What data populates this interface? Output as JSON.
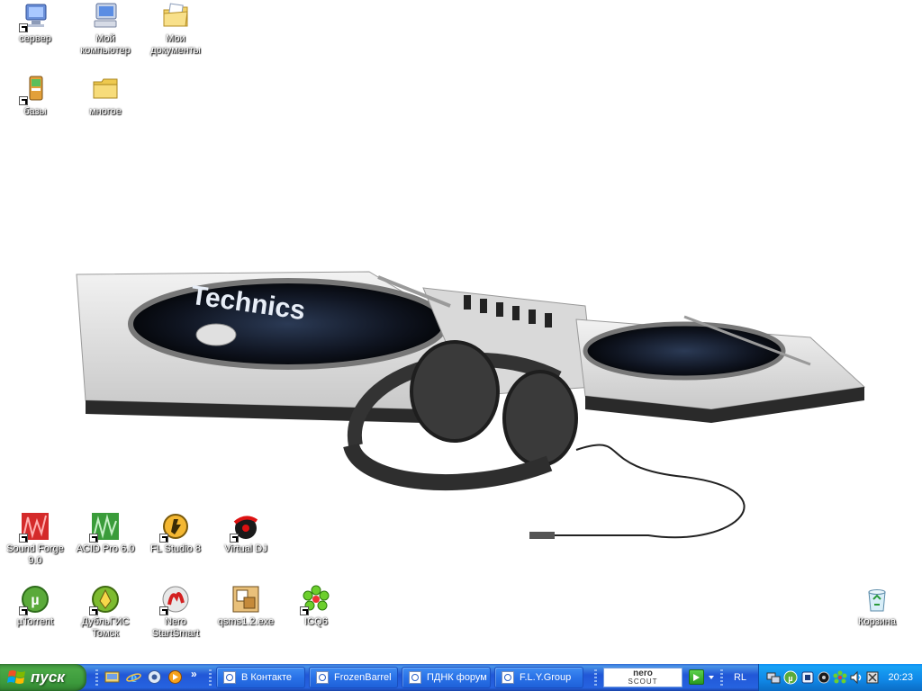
{
  "desktop": {
    "icons": [
      {
        "label": "сервер",
        "icon": "network-computer-icon"
      },
      {
        "label": "Мой компьютер",
        "icon": "my-computer-icon"
      },
      {
        "label": "Мои документы",
        "icon": "my-documents-icon"
      },
      {
        "label": "базы",
        "icon": "database-icon"
      },
      {
        "label": "многое",
        "icon": "folder-icon"
      },
      {
        "label": "Sound Forge 9.0",
        "icon": "sound-forge-icon"
      },
      {
        "label": "ACID Pro 6.0",
        "icon": "acid-pro-icon"
      },
      {
        "label": "FL Studio 8",
        "icon": "fl-studio-icon"
      },
      {
        "label": "Virtual DJ",
        "icon": "virtual-dj-icon"
      },
      {
        "label": "µTorrent",
        "icon": "utorrent-icon"
      },
      {
        "label": "ДубльГИС Томск",
        "icon": "dublgis-icon"
      },
      {
        "label": "Nero StartSmart",
        "icon": "nero-icon"
      },
      {
        "label": "qsms1.2.exe",
        "icon": "qsms-icon"
      },
      {
        "label": "ICQ6",
        "icon": "icq-icon"
      },
      {
        "label": "Корзина",
        "icon": "recycle-bin-icon"
      }
    ],
    "wallpaper_brand": "Technics"
  },
  "taskbar": {
    "start_label": "пуск",
    "quick_launch": [
      "show-desktop-icon",
      "internet-explorer-icon",
      "browser-icon",
      "media-player-icon"
    ],
    "overflow": "»",
    "windows": [
      {
        "label": "В Контакте"
      },
      {
        "label": "FrozenBarrel"
      },
      {
        "label": "ПДНК форум"
      },
      {
        "label": "F.L.Y.Group"
      }
    ],
    "nero_scout": {
      "line1": "nero",
      "line2": "SCOUT"
    },
    "language": "RL",
    "tray_icons": [
      "network-icon",
      "utorrent-tray-icon",
      "agent-tray-icon",
      "audio-tray-icon",
      "icq-tray-icon",
      "volume-icon",
      "connection-icon"
    ],
    "clock": "20:23"
  },
  "colors": {
    "taskbar_blue": "#2157d7",
    "start_green": "#3c9a3c",
    "tray_blue": "#1087e6"
  }
}
